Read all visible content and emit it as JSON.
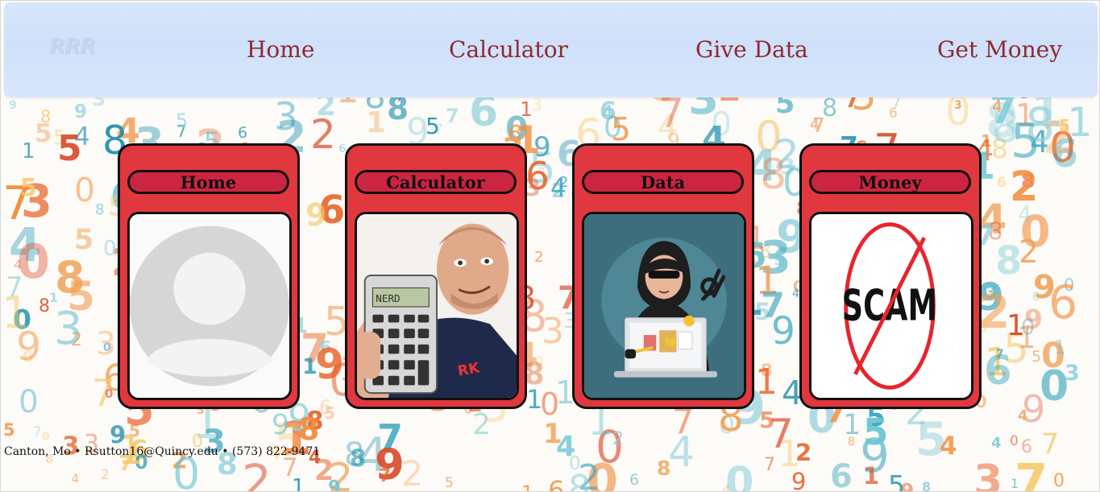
{
  "nav": {
    "logo_text": "RRR",
    "links": [
      "Home",
      "Calculator",
      "Give Data",
      "Get Money"
    ]
  },
  "cards": [
    {
      "title": "Home",
      "image": "default-avatar-icon"
    },
    {
      "title": "Calculator",
      "image": "man-holding-calculator-photo"
    },
    {
      "title": "Data",
      "image": "hacker-illustration"
    },
    {
      "title": "Money",
      "image": "no-scam-sign",
      "image_text": "SCAM"
    }
  ],
  "footer": {
    "text": "Canton, Mo • Rsutton16@Quincy.edu • (573) 822-9471"
  },
  "colors": {
    "nav_bg": "#d3e3fa",
    "nav_link": "#8e2a2f",
    "card_bg": "#e1383f",
    "card_title_bg": "#cc2541",
    "border": "#111111"
  }
}
